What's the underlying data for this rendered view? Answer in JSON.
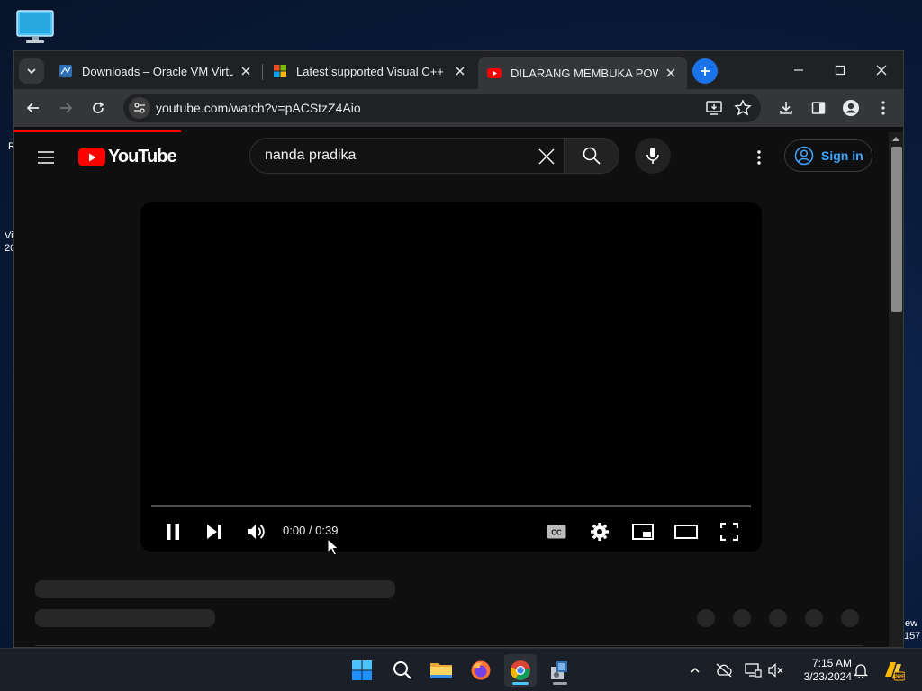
{
  "desktop": {
    "edge_text_left": [
      "R",
      "Vi",
      "20"
    ],
    "edge_text_right": [
      "ew",
      "157"
    ]
  },
  "browser": {
    "tabs": [
      {
        "title": "Downloads – Oracle VM VirtualBox",
        "icon": "virtualbox-icon"
      },
      {
        "title": "Latest supported Visual C++ Redistributable",
        "icon": "microsoft-icon"
      },
      {
        "title": "DILARANG MEMBUKA POWERPOINT",
        "icon": "youtube-icon",
        "active": true
      }
    ],
    "url": "youtube.com/watch?v=pACStzZ4Aio",
    "colors": {
      "accent": "#1a73e8",
      "youtube_red": "#ff0000",
      "signin_blue": "#3ea6ff"
    }
  },
  "youtube": {
    "logo_text": "YouTube",
    "search_value": "nanda pradika",
    "signin_label": "Sign in",
    "player": {
      "time": "0:00 / 0:39",
      "progress": 0
    }
  },
  "taskbar": {
    "time": "7:15 AM",
    "date": "3/23/2024",
    "apps": [
      "start-icon",
      "search-icon",
      "file-explorer-icon",
      "firefox-icon",
      "chrome-icon",
      "installer-icon"
    ]
  }
}
